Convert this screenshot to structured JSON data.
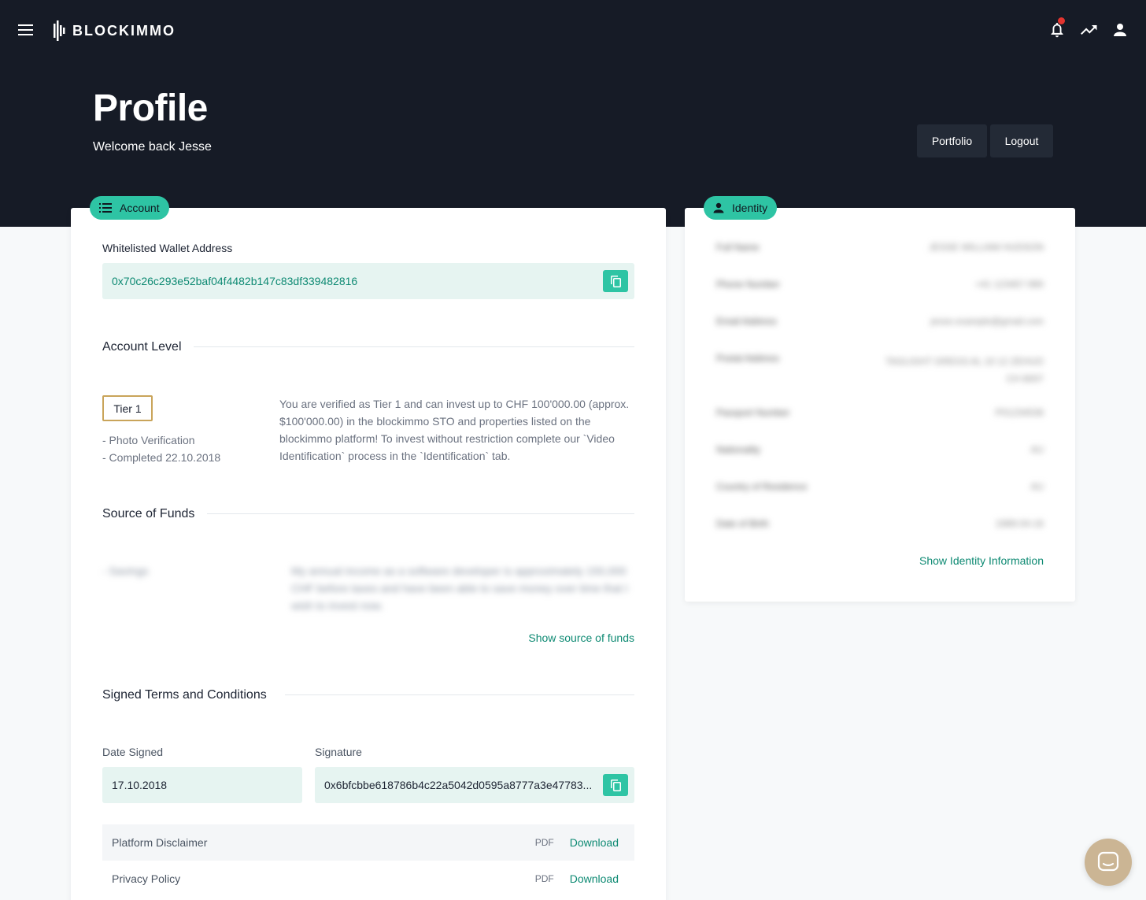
{
  "brand": {
    "name": "BLOCKIMMO"
  },
  "header": {
    "title": "Profile",
    "welcome": "Welcome back Jesse",
    "buttons": {
      "portfolio": "Portfolio",
      "logout": "Logout"
    }
  },
  "account": {
    "tab_label": "Account",
    "wallet": {
      "label": "Whitelisted Wallet Address",
      "address": "0x70c26c293e52baf04f4482b147c83df339482816"
    },
    "level": {
      "title": "Account Level",
      "tier": "Tier 1",
      "details": [
        "- Photo Verification",
        "- Completed 22.10.2018"
      ],
      "description": "You are verified as Tier 1 and can invest up to CHF 100'000.00 (approx. $100'000.00) in the blockimmo STO and properties listed on the blockimmo platform! To invest without restriction complete our `Video Identification` process in the `Identification` tab."
    },
    "funds": {
      "title": "Source of Funds",
      "source": "- Savings",
      "explanation": "My annual income as a software developer is approximately 150,000 CHF before taxes and have been able to save money over time that I wish to invest now.",
      "show_link": "Show source of funds"
    },
    "terms": {
      "title": "Signed Terms and Conditions",
      "date_label": "Date Signed",
      "date_value": "17.10.2018",
      "signature_label": "Signature",
      "signature_value": "0x6bfcbbe618786b4c22a5042d0595a8777a3e47783...",
      "documents": [
        {
          "name": "Platform Disclaimer",
          "type": "PDF",
          "action": "Download"
        },
        {
          "name": "Privacy Policy",
          "type": "PDF",
          "action": "Download"
        }
      ]
    }
  },
  "identity": {
    "tab_label": "Identity",
    "rows": [
      {
        "key": "Full Name",
        "value": "JESSE WILLIAM HUDSON"
      },
      {
        "key": "Phone Number",
        "value": "+41 123457 890"
      },
      {
        "key": "Email Address",
        "value": "jesse.example@gmail.com"
      },
      {
        "key": "Postal Address",
        "value": "TAGLIGHT GREGS AL 10 12 ZEHUO",
        "value2": "CH 8007"
      },
      {
        "key": "Passport Number",
        "value": "P01234536"
      },
      {
        "key": "Nationality",
        "value": "AU"
      },
      {
        "key": "Country of Residence",
        "value": "AU"
      },
      {
        "key": "Date of Birth",
        "value": "1989-04-16"
      }
    ],
    "show_link": "Show Identity Information"
  }
}
